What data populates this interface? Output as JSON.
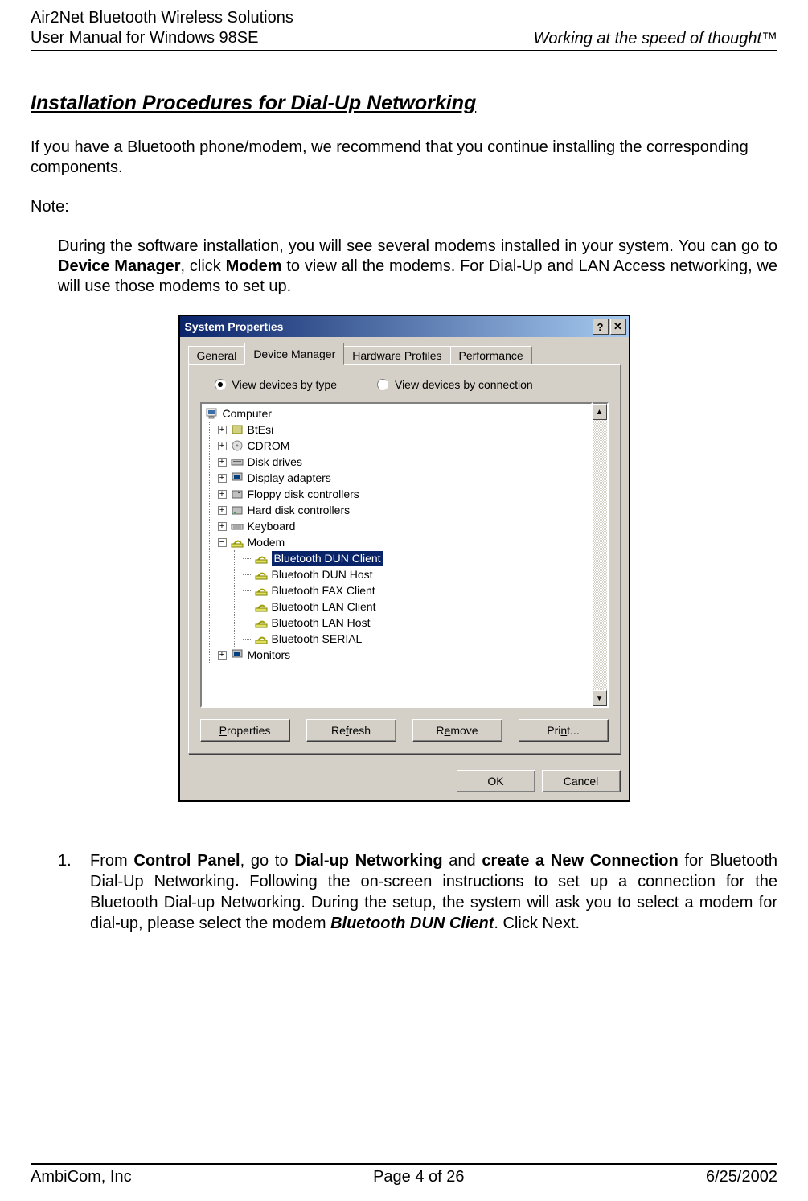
{
  "header": {
    "line1": "Air2Net Bluetooth Wireless Solutions",
    "line2": "User Manual for Windows 98SE",
    "tagline_prefix": "Working at the speed of thought",
    "tagline_tm": "™"
  },
  "section_title": "Installation Procedures for Dial-Up Networking",
  "intro": "If you have a Bluetooth phone/modem, we recommend that you continue installing the corresponding components.",
  "note_label": "Note:",
  "note_body": {
    "p1": "During the software installation, you will see several modems installed in your system.  You can go to ",
    "b1": "Device Manager",
    "p2": ", click ",
    "b2": "Modem",
    "p3": " to view all the modems. For Dial-Up and LAN Access networking, we will use those modems to set up."
  },
  "dialog": {
    "title": "System Properties",
    "help_glyph": "?",
    "close_glyph": "✕",
    "tabs": [
      "General",
      "Device Manager",
      "Hardware Profiles",
      "Performance"
    ],
    "active_tab": 1,
    "radio1": "View devices by type",
    "radio2": "View devices by connection",
    "tree_root": "Computer",
    "tree_top": [
      "BtEsi",
      "CDROM",
      "Disk drives",
      "Display adapters",
      "Floppy disk controllers",
      "Hard disk controllers",
      "Keyboard"
    ],
    "modem_label": "Modem",
    "modem_children": [
      "Bluetooth DUN Client",
      "Bluetooth DUN Host",
      "Bluetooth FAX Client",
      "Bluetooth LAN Client",
      "Bluetooth LAN Host",
      "Bluetooth SERIAL"
    ],
    "selected_child": 0,
    "tree_bottom_label": "Monitors",
    "buttons": {
      "properties": "Properties",
      "refresh": "Refresh",
      "remove": "Remove",
      "print": "Print..."
    },
    "ok": "OK",
    "cancel": "Cancel",
    "scroll_up": "▲",
    "scroll_down": "▼"
  },
  "step1": {
    "num": "1.",
    "t1": "From ",
    "b1": "Control Panel",
    "t2": ", go to ",
    "b2": "Dial-up Networking",
    "t3": " and ",
    "b3": "create a New Connection ",
    "t4": "for Bluetooth Dial-Up Networking",
    "b4": ".",
    "t5": "  Following the on-screen instructions to set up a connection for the Bluetooth Dial-up Networking. During the setup, the system will ask you to select a modem for dial-up, please select the modem ",
    "bi1": "Bluetooth DUN Client",
    "t6": ".   Click Next."
  },
  "footer": {
    "left": "AmbiCom, Inc",
    "center": "Page 4 of 26",
    "right": "6/25/2002"
  }
}
